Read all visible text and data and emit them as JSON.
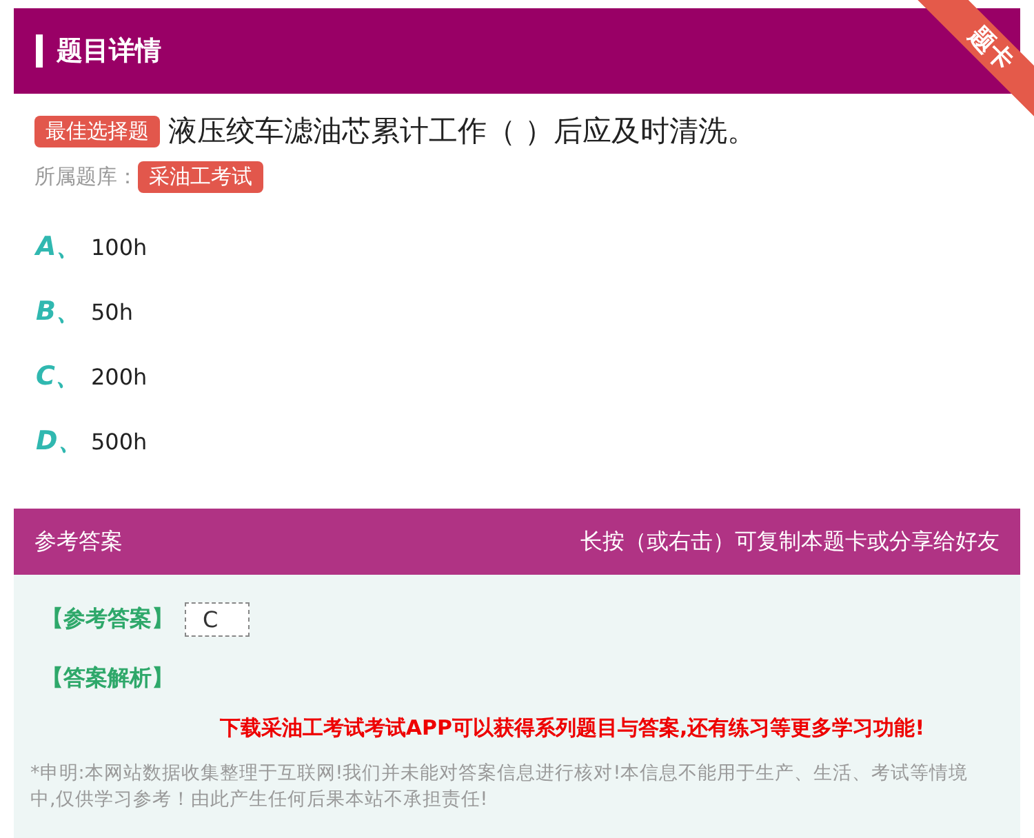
{
  "header": {
    "title": "题目详情",
    "corner_tag": "题卡"
  },
  "question": {
    "type_badge": "最佳选择题",
    "text": "液压绞车滤油芯累计工作（ ）后应及时清洗。",
    "bank_label": "所属题库：",
    "bank": "采油工考试"
  },
  "options": [
    {
      "letter": "A、",
      "text": "100h"
    },
    {
      "letter": "B、",
      "text": "50h"
    },
    {
      "letter": "C、",
      "text": "200h"
    },
    {
      "letter": "D、",
      "text": "500h"
    }
  ],
  "answer": {
    "title": "参考答案",
    "hint": "长按（或右击）可复制本题卡或分享给好友",
    "answer_label": "【参考答案】",
    "answer_value": "C",
    "analysis_label": "【答案解析】",
    "promo": "下载采油工考试考试APP可以获得系列题目与答案,还有练习等更多学习功能!",
    "disclaimer": "*申明:本网站数据收集整理于互联网!我们并未能对答案信息进行核对!本信息不能用于生产、生活、考试等情境中,仅供学习参考！由此产生任何后果本站不承担责任!"
  }
}
